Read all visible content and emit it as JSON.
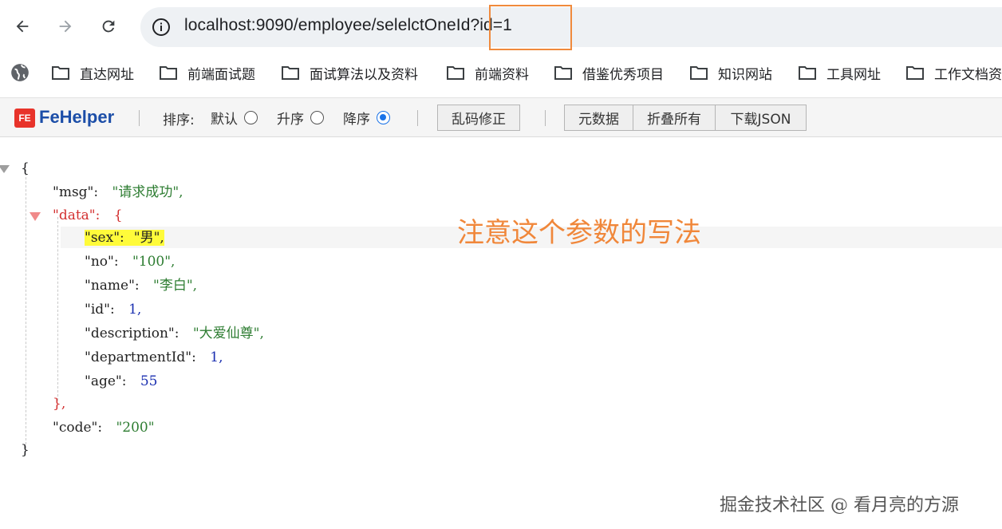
{
  "browser": {
    "url": "localhost:9090/employee/selelctOneId?id=1"
  },
  "bookmarks": [
    {
      "label": "直达网址"
    },
    {
      "label": "前端面试题"
    },
    {
      "label": "面试算法以及资料"
    },
    {
      "label": "前端资料"
    },
    {
      "label": "借鉴优秀项目"
    },
    {
      "label": "知识网站"
    },
    {
      "label": "工具网址"
    },
    {
      "label": "工作文档资"
    }
  ],
  "fehelper": {
    "title": "FeHelper",
    "logo_text": "FE",
    "sort_label": "排序:",
    "sort_options": [
      "默认",
      "升序",
      "降序"
    ],
    "sort_selected": "降序",
    "fix_encoding": "乱码修正",
    "metadata": "元数据",
    "collapse_all": "折叠所有",
    "download_json": "下载JSON"
  },
  "json": {
    "open_brace": "{",
    "close_brace": "}",
    "msg_key": "\"msg\":",
    "msg_value": "\"请求成功\",",
    "data_key": "\"data\":",
    "data_open": "{",
    "data_close": "},",
    "fields": [
      {
        "key": "\"sex\":",
        "value": "\"男\",",
        "type": "str"
      },
      {
        "key": "\"no\":",
        "value": "\"100\",",
        "type": "str"
      },
      {
        "key": "\"name\":",
        "value": "\"李白\",",
        "type": "str"
      },
      {
        "key": "\"id\":",
        "value": "1,",
        "type": "num"
      },
      {
        "key": "\"description\":",
        "value": "\"大爱仙尊\",",
        "type": "str"
      },
      {
        "key": "\"departmentId\":",
        "value": "1,",
        "type": "num"
      },
      {
        "key": "\"age\":",
        "value": "55",
        "type": "num"
      }
    ],
    "code_key": "\"code\":",
    "code_value": "\"200\""
  },
  "annotation": "注意这个参数的写法",
  "watermark": "掘金技术社区 @ 看月亮的方源",
  "colors": {
    "highlight_box": "#f08a3c",
    "annotation": "#f0873a",
    "string_value": "#2e7d32",
    "number_value": "#1a2fb0",
    "data_key": "#d32f2f",
    "selected_row": "#fffb3a"
  }
}
